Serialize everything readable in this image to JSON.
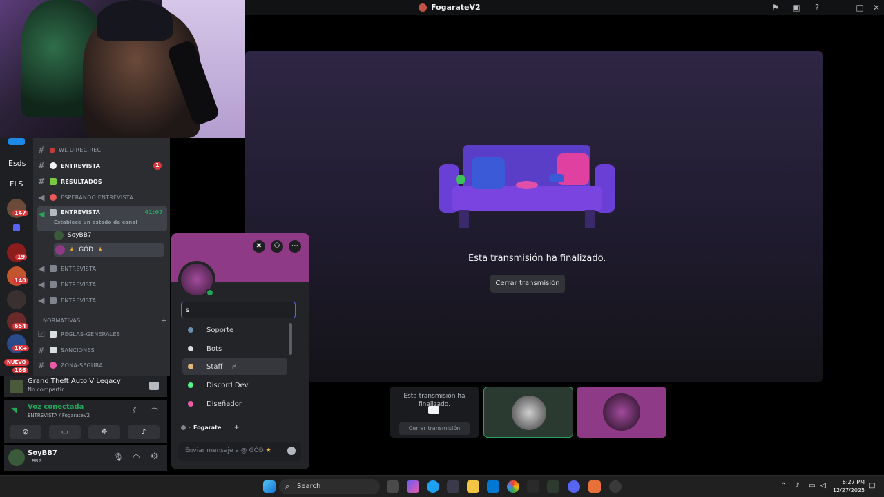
{
  "window": {
    "title": "FogarateV2"
  },
  "servers": {
    "labels": [
      "Esds",
      "FLS"
    ],
    "badges": [
      "147",
      "19",
      "140",
      "654",
      "1K+",
      "166"
    ],
    "new_label": "NUEVO"
  },
  "channels": {
    "items": [
      {
        "name": "WL-DIREC-REC"
      },
      {
        "name": "ENTREVISTA",
        "badge": "1"
      },
      {
        "name": "RESULTADOS"
      },
      {
        "name": "ESPERANDO ENTREVISTA"
      },
      {
        "name": "ENTREVISTA",
        "time": "41:07",
        "status_hint": "Establece un estado de canal"
      },
      {
        "name": "ENTREVISTA"
      },
      {
        "name": "ENTREVISTA"
      },
      {
        "name": "ENTREVISTA"
      },
      {
        "name": "REGLAS-GENERALES"
      },
      {
        "name": "SANCIONES"
      },
      {
        "name": "ZONA-SEGURA"
      }
    ],
    "voice_users": [
      "SoyBB7",
      "GÓÐ"
    ],
    "category": "NORMATIVAS"
  },
  "game": {
    "title": "Grand Theft Auto V Legacy",
    "subtitle": "No compartir"
  },
  "voice": {
    "status": "Voz conectada",
    "location": "ENTREVISTA / FogarateV2"
  },
  "user": {
    "name": "SoyBB7",
    "tag": "BB7"
  },
  "stream": {
    "ended_text": "Esta transmisión ha finalizado.",
    "close_label": "Cerrar transmisión"
  },
  "thumbnails": {
    "ended_text": "Esta transmisión ha finalizado.",
    "close_label": "Cerrar transmisión"
  },
  "popout": {
    "role_search_value": "s",
    "roles": [
      {
        "name": "Soporte",
        "color": "#6a8fb0"
      },
      {
        "name": "Bots",
        "color": "#dbdee1"
      },
      {
        "name": "Staff",
        "color": "#e0b97a"
      },
      {
        "name": "Discord Dev",
        "color": "#57f287"
      },
      {
        "name": "Diseñador",
        "color": "#eb5ca8"
      }
    ],
    "role_tag": "Fogarate",
    "message_placeholder": "Enviar mensaje a @ GÓÐ"
  },
  "taskbar": {
    "search_label": "Search",
    "time": "6:27 PM",
    "date": "12/27/2025"
  },
  "colors": {
    "accent": "#5865f2",
    "online": "#23a55a",
    "banner": "#8e3a86"
  }
}
